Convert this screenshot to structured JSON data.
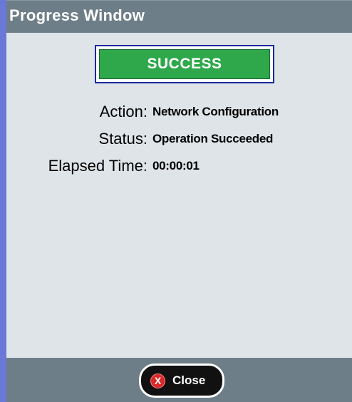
{
  "window": {
    "title": "Progress Window"
  },
  "status": {
    "text": "SUCCESS",
    "color": "#2ea84a"
  },
  "details": [
    {
      "label": "Action:",
      "value": "Network Configuration"
    },
    {
      "label": "Status:",
      "value": "Operation Succeeded"
    },
    {
      "label": "Elapsed Time:",
      "value": "00:00:01"
    }
  ],
  "footer": {
    "close_label": "Close",
    "close_icon_glyph": "X",
    "close_icon_name": "close-icon"
  },
  "colors": {
    "titlebar": "#6e7e88",
    "accent_border": "#6a78d8",
    "close_icon": "#d8282a"
  }
}
